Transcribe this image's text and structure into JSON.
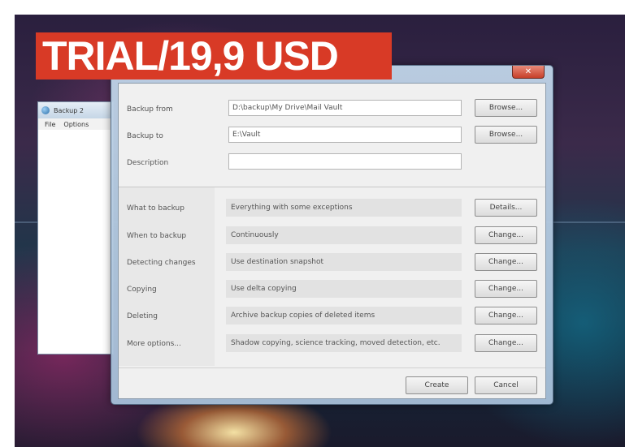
{
  "banner": "TRIAL/19,9 USD",
  "background_window": {
    "title": "Backup 2",
    "menu": [
      "File",
      "Options"
    ]
  },
  "dialog": {
    "close_label": "✕",
    "fields": [
      {
        "label": "Backup from",
        "value": "D:\\backup\\My Drive\\Mail Vault",
        "button": "Browse..."
      },
      {
        "label": "Backup to",
        "value": "E:\\Vault",
        "button": "Browse..."
      },
      {
        "label": "Description",
        "value": "",
        "button": null
      }
    ],
    "settings": [
      {
        "label": "What to backup",
        "value": "Everything with some exceptions",
        "button": "Details..."
      },
      {
        "label": "When to backup",
        "value": "Continuously",
        "button": "Change..."
      },
      {
        "label": "Detecting changes",
        "value": "Use destination snapshot",
        "button": "Change..."
      },
      {
        "label": "Copying",
        "value": "Use delta copying",
        "button": "Change..."
      },
      {
        "label": "Deleting",
        "value": "Archive backup copies of deleted items",
        "button": "Change..."
      },
      {
        "label": "More options...",
        "value": "Shadow copying, science tracking, moved detection, etc.",
        "button": "Change..."
      }
    ],
    "create_label": "Create",
    "cancel_label": "Cancel"
  }
}
